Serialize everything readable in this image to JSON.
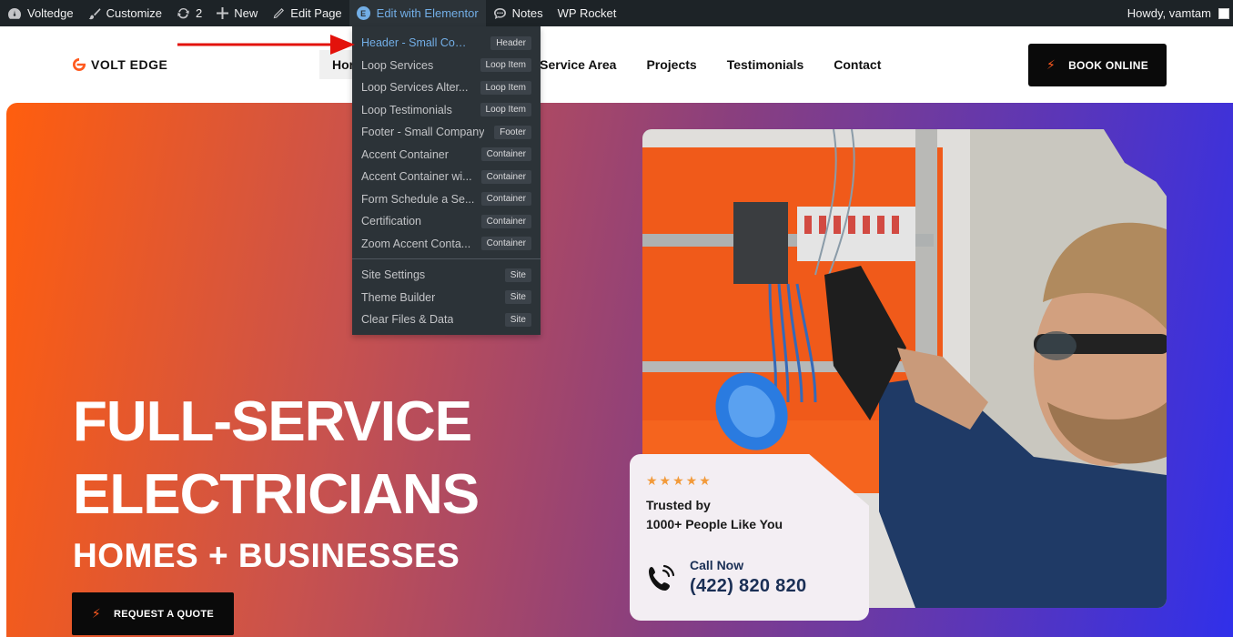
{
  "adminbar": {
    "site_name": "Voltedge",
    "customize": "Customize",
    "updates_count": "2",
    "new": "New",
    "edit_page": "Edit Page",
    "edit_elementor": "Edit with Elementor",
    "notes": "Notes",
    "wp_rocket": "WP Rocket",
    "howdy": "Howdy, vamtam",
    "elementor_logo": "E"
  },
  "dropdown": {
    "items": [
      {
        "label": "Header - Small Comp...",
        "tag": "Header"
      },
      {
        "label": "Loop Services",
        "tag": "Loop Item"
      },
      {
        "label": "Loop Services Alter...",
        "tag": "Loop Item"
      },
      {
        "label": "Loop Testimonials",
        "tag": "Loop Item"
      },
      {
        "label": "Footer - Small Company",
        "tag": "Footer"
      },
      {
        "label": "Accent Container",
        "tag": "Container"
      },
      {
        "label": "Accent Container wi...",
        "tag": "Container"
      },
      {
        "label": "Form Schedule a Se...",
        "tag": "Container"
      },
      {
        "label": "Certification",
        "tag": "Container"
      },
      {
        "label": "Zoom Accent Conta...",
        "tag": "Container"
      }
    ],
    "site_items": [
      {
        "label": "Site Settings",
        "tag": "Site"
      },
      {
        "label": "Theme Builder",
        "tag": "Site"
      },
      {
        "label": "Clear Files & Data",
        "tag": "Site"
      }
    ]
  },
  "header": {
    "logo_text": "VOLT EDGE",
    "nav": {
      "home": "Hor",
      "service_area": "Service Area",
      "projects": "Projects",
      "testimonials": "Testimonials",
      "contact": "Contact"
    },
    "book_button": "BOOK ONLINE"
  },
  "hero": {
    "title_line1": "FULL-SERVICE",
    "title_line2": "ELECTRICIANS",
    "subtitle": "HOMES + BUSINESSES",
    "quote_button": "REQUEST A QUOTE",
    "trust": {
      "stars": "★★★★★",
      "line1": "Trusted by",
      "line2": "1000+ People Like You",
      "call_label": "Call Now",
      "phone": "(422) 820 820"
    }
  },
  "colors": {
    "admin_bar": "#1d2327",
    "dropdown_bg": "#2c3338",
    "highlight_link": "#72aee6",
    "accent_orange": "#ff5a1f",
    "arrow_red": "#e3120b"
  }
}
